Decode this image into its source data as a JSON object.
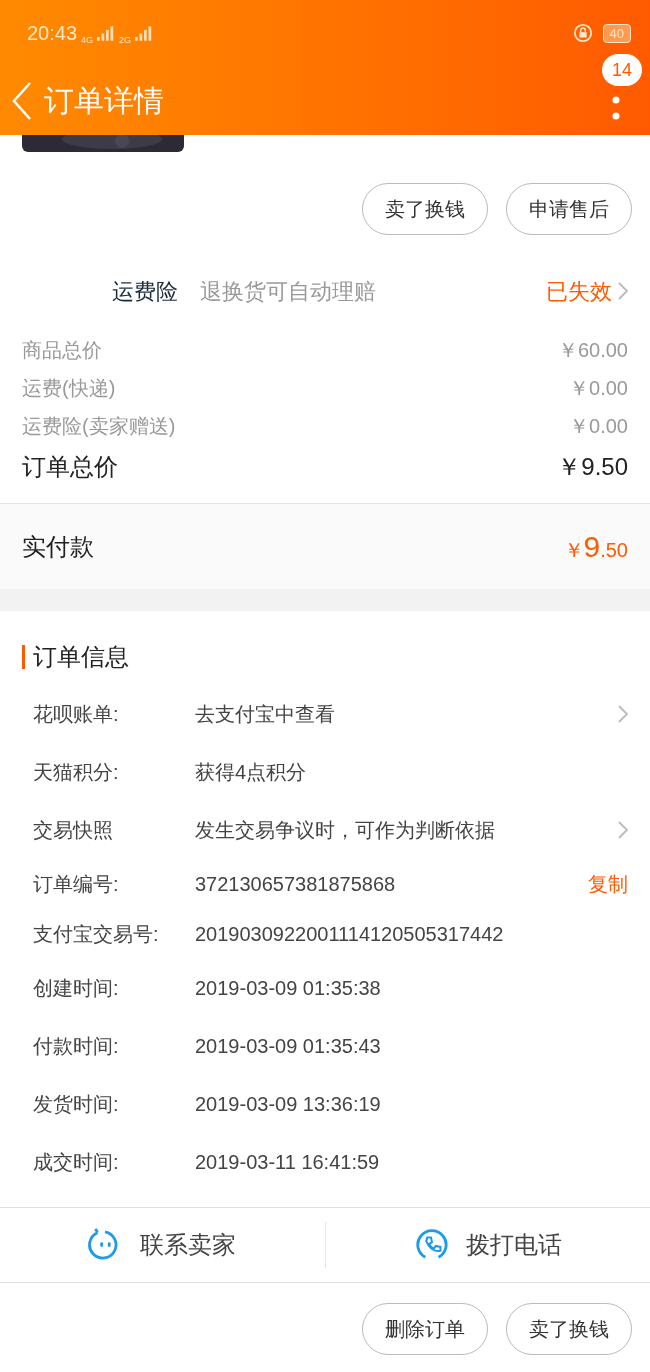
{
  "status_bar": {
    "time": "20:43",
    "network_1": "4G",
    "network_2": "2G",
    "battery": "40"
  },
  "header": {
    "title": "订单详情",
    "badge": "14"
  },
  "top_actions": [
    {
      "label": "卖了换钱"
    },
    {
      "label": "申请售后"
    }
  ],
  "insurance": {
    "name": "运费险",
    "description": "退换货可自动理赔",
    "status": "已失效"
  },
  "price_rows": [
    {
      "label": "商品总价",
      "value": "￥60.00",
      "kind": "minor"
    },
    {
      "label": "运费(快递)",
      "value": "￥0.00",
      "kind": "minor"
    },
    {
      "label": "运费险(卖家赠送)",
      "value": "￥0.00",
      "kind": "minor"
    },
    {
      "label": "订单总价",
      "value": "￥9.50",
      "kind": "total"
    }
  ],
  "paid": {
    "label": "实付款",
    "currency": "￥",
    "integer": "9",
    "fraction": ".50"
  },
  "order_info": {
    "title": "订单信息",
    "rows": [
      {
        "label": "花呗账单:",
        "value": "去支付宝中查看",
        "kind": "link"
      },
      {
        "label": "天猫积分:",
        "value": "获得4点积分",
        "kind": "plain"
      },
      {
        "label": "交易快照",
        "value": "发生交易争议时，可作为判断依据",
        "kind": "link"
      },
      {
        "label": "订单编号:",
        "value": "372130657381875868",
        "kind": "action",
        "action": "复制"
      },
      {
        "label": "支付宝交易号:",
        "value": "2019030922001114120505317442",
        "kind": "plain"
      },
      {
        "label": "创建时间:",
        "value": "2019-03-09 01:35:38",
        "kind": "plain"
      },
      {
        "label": "付款时间:",
        "value": "2019-03-09 01:35:43",
        "kind": "plain"
      },
      {
        "label": "发货时间:",
        "value": "2019-03-09 13:36:19",
        "kind": "plain"
      },
      {
        "label": "成交时间:",
        "value": "2019-03-11 16:41:59",
        "kind": "plain"
      }
    ]
  },
  "contact_bar": [
    {
      "label": "联系卖家",
      "kind": "chat"
    },
    {
      "label": "拨打电话",
      "kind": "phone"
    }
  ],
  "bottom_actions": [
    {
      "label": "删除订单"
    },
    {
      "label": "卖了换钱"
    }
  ]
}
